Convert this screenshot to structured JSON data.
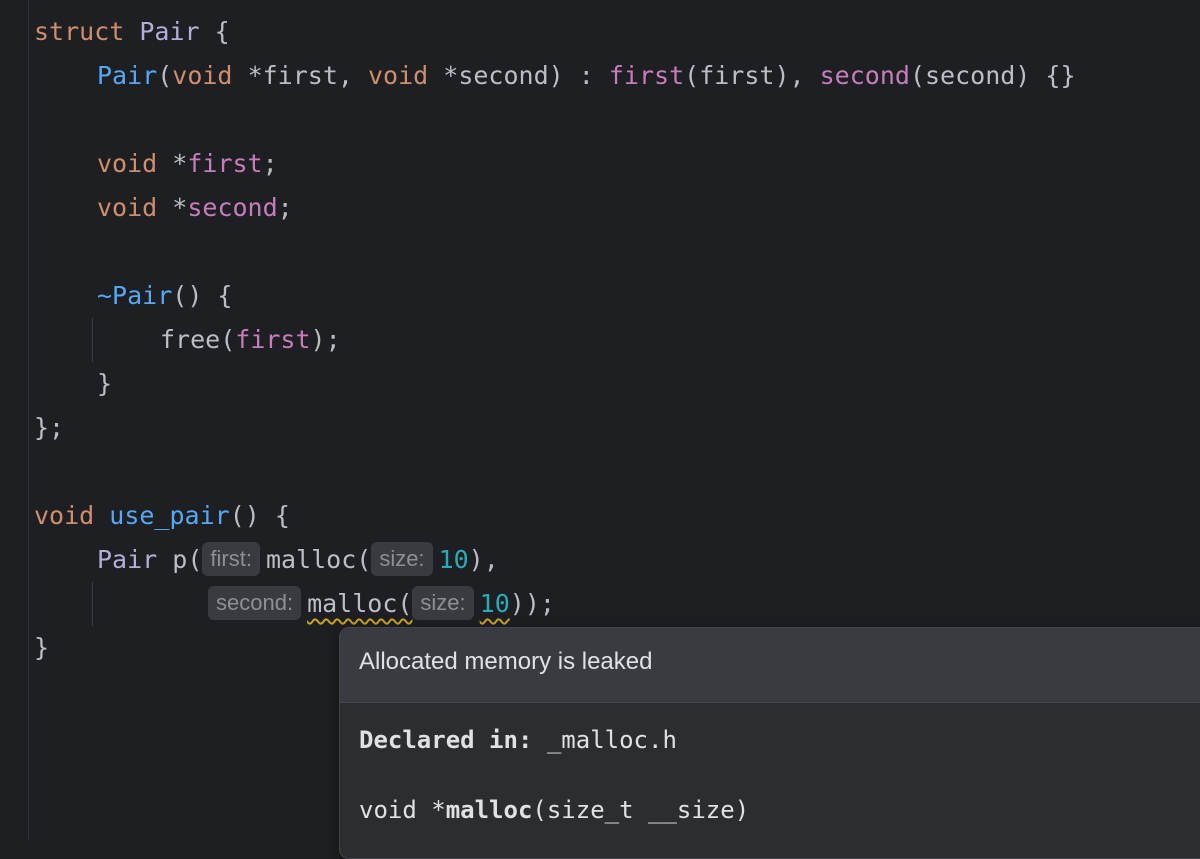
{
  "editor": {
    "lines": {
      "l1": {
        "kw": "struct",
        "name": "Pair",
        "brace": "{"
      },
      "l2": {
        "ctor": "Pair",
        "p1_kw": "void",
        "p1": "*first,",
        "p2_kw": "void",
        "p2": "*second)",
        "colon": ":",
        "init1": "first",
        "init1_arg": "(first),",
        "init2": "second",
        "init2_arg": "(second)",
        "body": "{}"
      },
      "l4": {
        "kw": "void",
        "ptr": "*",
        "field": "first",
        "semi": ";"
      },
      "l5": {
        "kw": "void",
        "ptr": "*",
        "field": "second",
        "semi": ";"
      },
      "l7": {
        "dtor": "~Pair",
        "rest": "() {"
      },
      "l8": {
        "fn": "free(",
        "arg": "first",
        "end": ");"
      },
      "l9": {
        "text": "}"
      },
      "l10": {
        "text": "};"
      },
      "l12": {
        "kw": "void",
        "fn": "use_pair",
        "rest": "() {"
      },
      "l13": {
        "type": "Pair",
        "var": "p(",
        "hint1": "first:",
        "call": "malloc(",
        "hint2": "size:",
        "num": "10",
        "end": "),"
      },
      "l14": {
        "hint1": "second:",
        "call": "malloc(",
        "hint2": "size:",
        "num": "10",
        "end": "));"
      },
      "l15": {
        "text": "}"
      }
    }
  },
  "popup": {
    "title": "Allocated memory is leaked",
    "declared_label": "Declared in:",
    "declared_file": "_malloc.h",
    "sig_ret": "void *",
    "sig_name": "malloc",
    "sig_args": "(size_t __size)"
  }
}
